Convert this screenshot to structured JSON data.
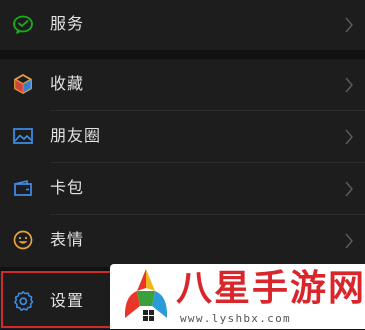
{
  "menu": {
    "items": [
      {
        "label": "服务",
        "icon": "wechat-pay-icon",
        "color": "#1aad19"
      },
      {
        "label": "收藏",
        "icon": "favorites-cube-icon",
        "color": "#e8a33d"
      },
      {
        "label": "朋友圈",
        "icon": "moments-picture-icon",
        "color": "#3e8fe8"
      },
      {
        "label": "卡包",
        "icon": "card-wallet-icon",
        "color": "#3e8fe8"
      },
      {
        "label": "表情",
        "icon": "emoji-face-icon",
        "color": "#e8a33d"
      },
      {
        "label": "设置",
        "icon": "settings-gear-icon",
        "color": "#3e8fe8"
      }
    ]
  },
  "watermark": {
    "title": "八星手游网",
    "url": "www.lyshbx.com",
    "accent_color": "#d8262b"
  },
  "highlight_color": "#d22a2a"
}
